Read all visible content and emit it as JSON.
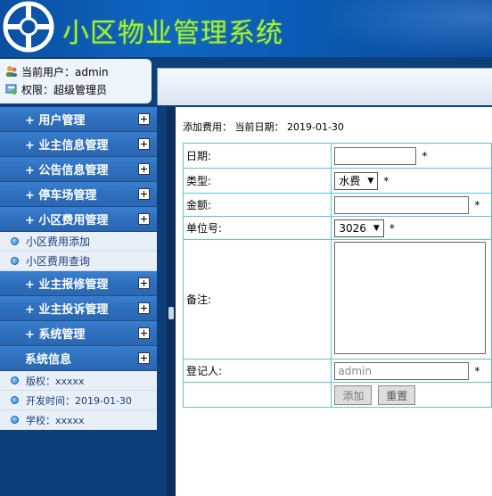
{
  "app": {
    "title": "小区物业管理系统"
  },
  "user": {
    "current_label": "当前用户：admin",
    "role_label": "权限：超级管理员"
  },
  "menu": {
    "items": [
      {
        "label": "+ 用户管理"
      },
      {
        "label": "+ 业主信息管理"
      },
      {
        "label": "+ 公告信息管理"
      },
      {
        "label": "+ 停车场管理"
      },
      {
        "label": "+ 小区费用管理"
      }
    ],
    "fee_subitems": [
      {
        "label": "小区费用添加"
      },
      {
        "label": "小区费用查询"
      }
    ],
    "items_after": [
      {
        "label": "+ 业主报修管理"
      },
      {
        "label": "+ 业主投诉管理"
      },
      {
        "label": "+ 系统管理"
      },
      {
        "label": "系统信息"
      }
    ],
    "system_info": [
      {
        "text": "版权：xxxxx"
      },
      {
        "text": "开发时间：2019-01-30"
      },
      {
        "text": "学校：xxxxx"
      }
    ]
  },
  "form": {
    "caption": "添加费用：  当前日期：  2019-01-30",
    "date_label": "日期:",
    "type_label": "类型:",
    "type_value": "水费",
    "amount_label": "金额:",
    "unit_label": "单位号:",
    "unit_value": "3026",
    "remark_label": "备注:",
    "recorder_label": "登记人:",
    "recorder_value": "admin",
    "required_mark": "*",
    "add_button": "添加",
    "reset_button": "重置"
  }
}
